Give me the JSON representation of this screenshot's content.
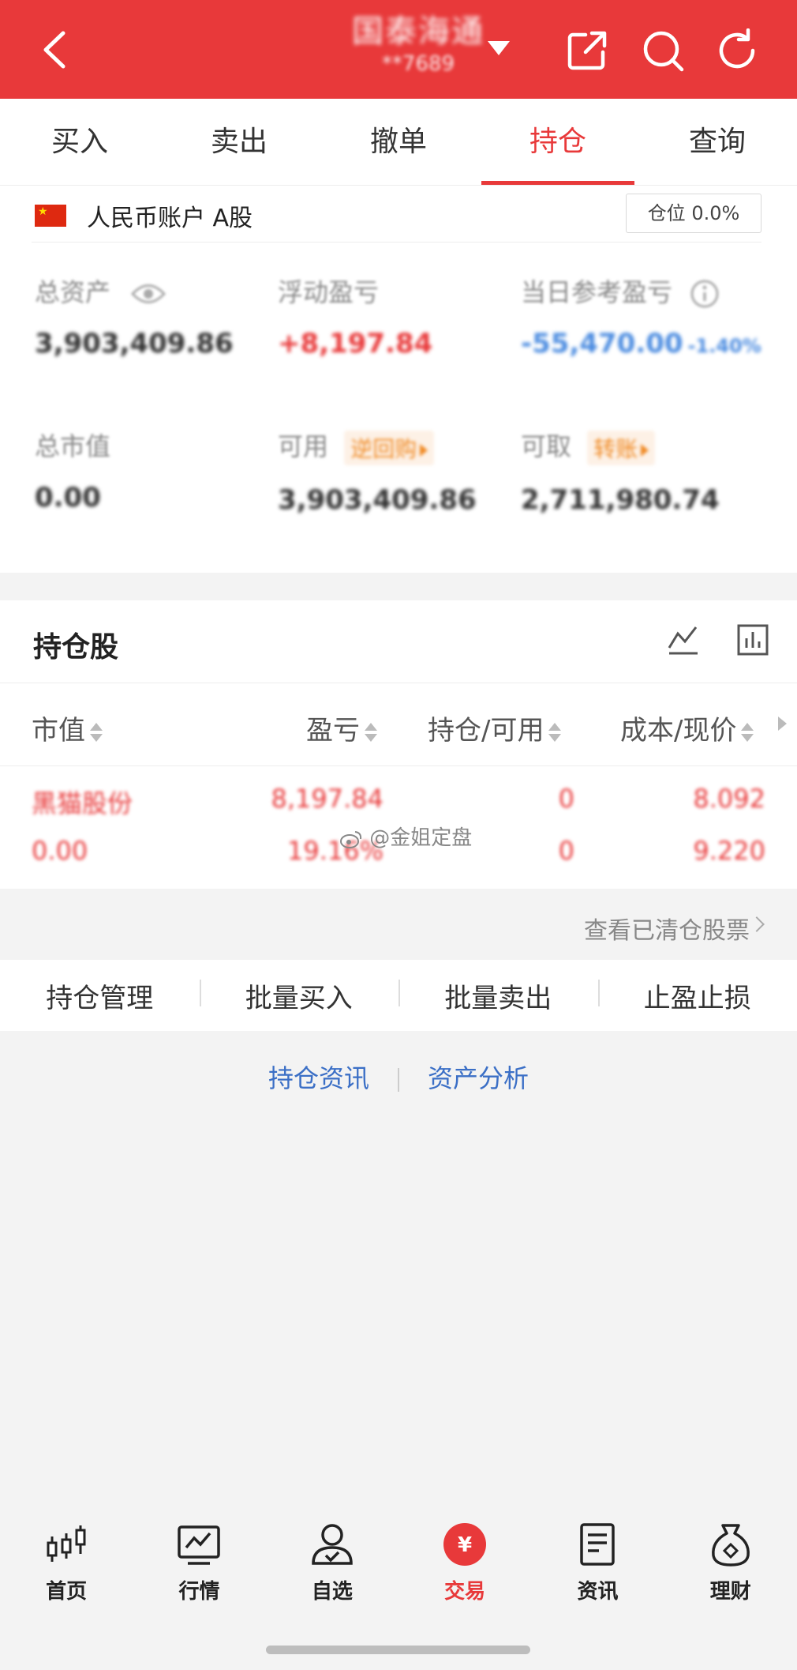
{
  "header": {
    "title": "国泰海通",
    "account": "**7689",
    "icons": [
      "back-icon",
      "share-icon",
      "search-icon",
      "refresh-icon"
    ],
    "bg_color": "#e8393a"
  },
  "tabs": [
    {
      "label": "买入",
      "active": false
    },
    {
      "label": "卖出",
      "active": false
    },
    {
      "label": "撤单",
      "active": false
    },
    {
      "label": "持仓",
      "active": true
    },
    {
      "label": "查询",
      "active": false
    }
  ],
  "account": {
    "name": "人民币账户 A股",
    "position_ratio": "仓位 0.0%"
  },
  "metrics": {
    "total_assets_label": "总资产",
    "total_assets": "3,903,409.86",
    "floating_pl_label": "浮动盈亏",
    "floating_pl": "+8,197.84",
    "daily_pl_label": "当日参考盈亏",
    "daily_pl": "-55,470.00",
    "daily_pl_pct": "-1.40%",
    "market_value_label": "总市值",
    "market_value": "0.00",
    "available_label": "可用",
    "available_tag": "逆回购",
    "available": "3,903,409.86",
    "withdrawable_label": "可取",
    "withdrawable_tag": "转账",
    "withdrawable": "2,711,980.74"
  },
  "holdings": {
    "title": "持仓股",
    "columns": [
      "市值",
      "盈亏",
      "持仓/可用",
      "成本/现价"
    ],
    "rows": [
      {
        "name": "黑猫股份",
        "market_value": "0.00",
        "pl": "8,197.84",
        "pl_pct": "19.16%",
        "position": "0",
        "available": "0",
        "cost": "8.092",
        "price": "9.220"
      }
    ],
    "watermark": "@金姐定盘",
    "view_cleared": "查看已清仓股票"
  },
  "actions": [
    "持仓管理",
    "批量买入",
    "批量卖出",
    "止盈止损"
  ],
  "links": [
    "持仓资讯",
    "资产分析"
  ],
  "bottom_nav": [
    {
      "label": "首页",
      "icon": "candlestick-icon",
      "active": false
    },
    {
      "label": "行情",
      "icon": "chart-icon",
      "active": false
    },
    {
      "label": "自选",
      "icon": "user-check-icon",
      "active": false
    },
    {
      "label": "交易",
      "icon": "yuan-icon",
      "active": true
    },
    {
      "label": "资讯",
      "icon": "document-icon",
      "active": false
    },
    {
      "label": "理财",
      "icon": "money-bag-icon",
      "active": false
    }
  ]
}
